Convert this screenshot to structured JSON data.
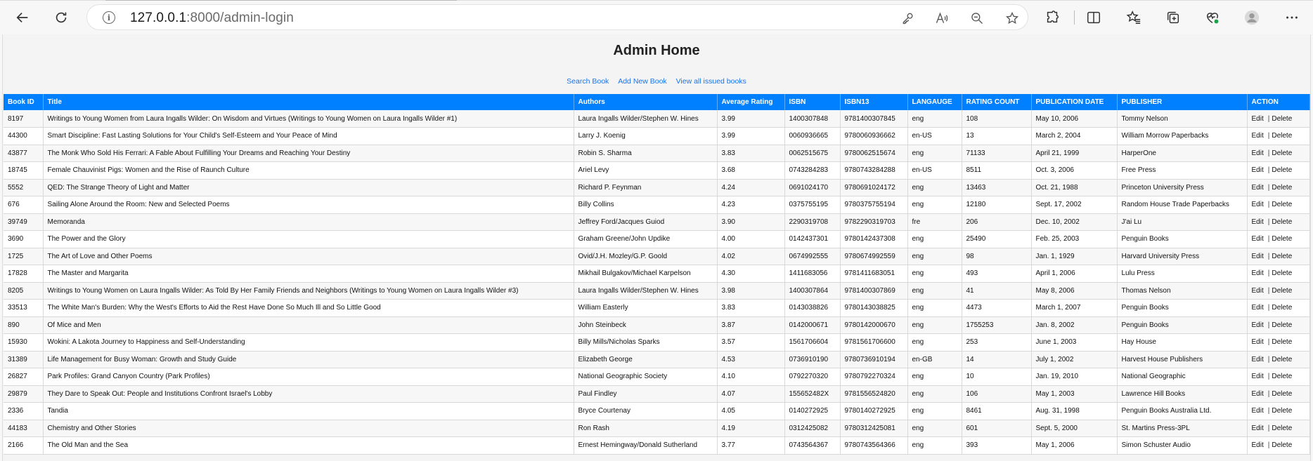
{
  "browser": {
    "url_host": "127.0.0.1",
    "url_rest": ":8000/admin-login"
  },
  "page": {
    "title": "Admin Home",
    "links": [
      "Search Book",
      "Add New Book",
      "View all issued books"
    ]
  },
  "table": {
    "headers": [
      "Book ID",
      "Title",
      "Authors",
      "Average Rating",
      "ISBN",
      "ISBN13",
      "LANGAUGE",
      "RATING COUNT",
      "PUBLICATION DATE",
      "PUBLISHER",
      "ACTION"
    ],
    "edit_label": "Edit",
    "delete_label": "Delete",
    "rows": [
      [
        "8197",
        "Writings to Young Women from Laura Ingalls Wilder: On Wisdom and Virtues (Writings to Young Women on Laura Ingalls Wilder #1)",
        "Laura Ingalls Wilder/Stephen W. Hines",
        "3.99",
        "1400307848",
        "9781400307845",
        "eng",
        "108",
        "May 10, 2006",
        "Tommy Nelson"
      ],
      [
        "44300",
        "Smart Discipline: Fast Lasting Solutions for Your Child's Self-Esteem and Your Peace of Mind",
        "Larry J. Koenig",
        "3.99",
        "0060936665",
        "9780060936662",
        "en-US",
        "13",
        "March 2, 2004",
        "William Morrow Paperbacks"
      ],
      [
        "43877",
        "The Monk Who Sold His Ferrari: A Fable About Fulfilling Your Dreams and Reaching Your Destiny",
        "Robin S. Sharma",
        "3.83",
        "0062515675",
        "9780062515674",
        "eng",
        "71133",
        "April 21, 1999",
        "HarperOne"
      ],
      [
        "18745",
        "Female Chauvinist Pigs: Women and the Rise of Raunch Culture",
        "Ariel Levy",
        "3.68",
        "0743284283",
        "9780743284288",
        "en-US",
        "8511",
        "Oct. 3, 2006",
        "Free Press"
      ],
      [
        "5552",
        "QED: The Strange Theory of Light and Matter",
        "Richard P. Feynman",
        "4.24",
        "0691024170",
        "9780691024172",
        "eng",
        "13463",
        "Oct. 21, 1988",
        "Princeton University Press"
      ],
      [
        "676",
        "Sailing Alone Around the Room: New and Selected Poems",
        "Billy Collins",
        "4.23",
        "0375755195",
        "9780375755194",
        "eng",
        "12180",
        "Sept. 17, 2002",
        "Random House Trade Paperbacks"
      ],
      [
        "39749",
        "Memoranda",
        "Jeffrey Ford/Jacques Guiod",
        "3.90",
        "2290319708",
        "9782290319703",
        "fre",
        "206",
        "Dec. 10, 2002",
        "J'ai Lu"
      ],
      [
        "3690",
        "The Power and the Glory",
        "Graham Greene/John Updike",
        "4.00",
        "0142437301",
        "9780142437308",
        "eng",
        "25490",
        "Feb. 25, 2003",
        "Penguin Books"
      ],
      [
        "1725",
        "The Art of Love and Other Poems",
        "Ovid/J.H. Mozley/G.P. Goold",
        "4.02",
        "0674992555",
        "9780674992559",
        "eng",
        "98",
        "Jan. 1, 1929",
        "Harvard University Press"
      ],
      [
        "17828",
        "The Master and Margarita",
        "Mikhail Bulgakov/Michael Karpelson",
        "4.30",
        "1411683056",
        "9781411683051",
        "eng",
        "493",
        "April 1, 2006",
        "Lulu Press"
      ],
      [
        "8205",
        "Writings to Young Women on Laura Ingalls Wilder: As Told By Her Family Friends and Neighbors (Writings to Young Women on Laura Ingalls Wilder #3)",
        "Laura Ingalls Wilder/Stephen W. Hines",
        "3.98",
        "1400307864",
        "9781400307869",
        "eng",
        "41",
        "May 8, 2006",
        "Thomas Nelson"
      ],
      [
        "33513",
        "The White Man's Burden: Why the West's Efforts to Aid the Rest Have Done So Much Ill and So Little Good",
        "William Easterly",
        "3.83",
        "0143038826",
        "9780143038825",
        "eng",
        "4473",
        "March 1, 2007",
        "Penguin Books"
      ],
      [
        "890",
        "Of Mice and Men",
        "John Steinbeck",
        "3.87",
        "0142000671",
        "9780142000670",
        "eng",
        "1755253",
        "Jan. 8, 2002",
        "Penguin Books"
      ],
      [
        "15930",
        "Wokini: A Lakota Journey to Happiness and Self-Understanding",
        "Billy Mills/Nicholas Sparks",
        "3.57",
        "1561706604",
        "9781561706600",
        "eng",
        "253",
        "June 1, 2003",
        "Hay House"
      ],
      [
        "31389",
        "Life Management for Busy Woman: Growth and Study Guide",
        "Elizabeth George",
        "4.53",
        "0736910190",
        "9780736910194",
        "en-GB",
        "14",
        "July 1, 2002",
        "Harvest House Publishers"
      ],
      [
        "26827",
        "Park Profiles: Grand Canyon Country (Park Profiles)",
        "National Geographic Society",
        "4.10",
        "0792270320",
        "9780792270324",
        "eng",
        "10",
        "Jan. 19, 2010",
        "National Geographic"
      ],
      [
        "29879",
        "They Dare to Speak Out: People and Institutions Confront Israel's Lobby",
        "Paul Findley",
        "4.07",
        "155652482X",
        "9781556524820",
        "eng",
        "106",
        "May 1, 2003",
        "Lawrence Hill Books"
      ],
      [
        "2336",
        "Tandia",
        "Bryce Courtenay",
        "4.05",
        "0140272925",
        "9780140272925",
        "eng",
        "8461",
        "Aug. 31, 1998",
        "Penguin Books Australia Ltd."
      ],
      [
        "44183",
        "Chemistry and Other Stories",
        "Ron Rash",
        "4.19",
        "0312425082",
        "9780312425081",
        "eng",
        "601",
        "Sept. 5, 2000",
        "St. Martins Press-3PL"
      ],
      [
        "2166",
        "The Old Man and the Sea",
        "Ernest Hemingway/Donald Sutherland",
        "3.77",
        "0743564367",
        "9780743564366",
        "eng",
        "393",
        "May 1, 2006",
        "Simon Schuster Audio"
      ]
    ]
  }
}
